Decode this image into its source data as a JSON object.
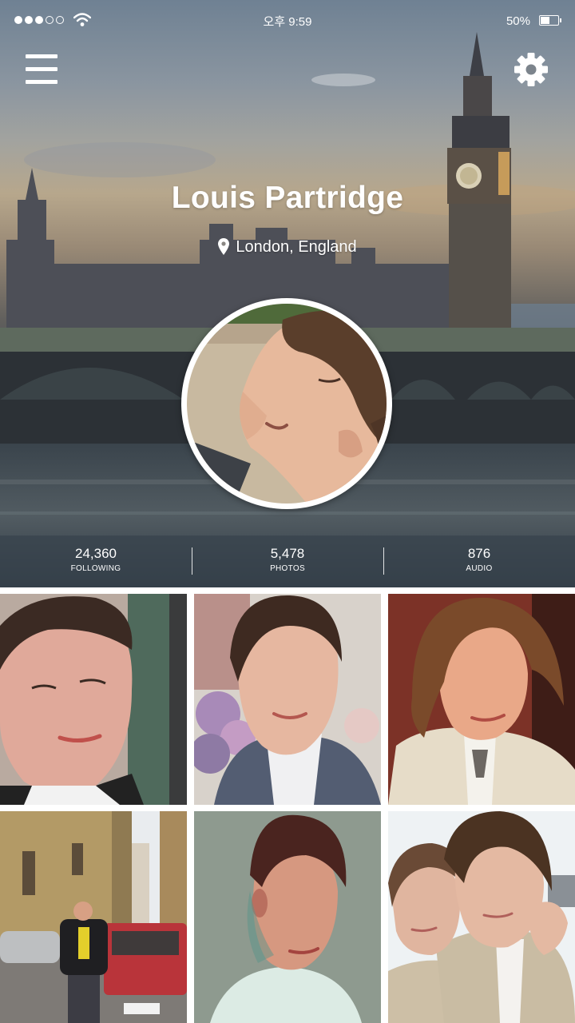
{
  "status_bar": {
    "signal": "●●●○○",
    "wifi_icon": "wifi-icon",
    "time": "오후 9:59",
    "battery_percent": "50%",
    "battery_level": 0.5
  },
  "nav": {
    "menu_icon": "hamburger-menu-icon",
    "settings_icon": "gear-icon"
  },
  "profile": {
    "name": "Louis Partridge",
    "location": "London, England",
    "location_icon": "map-pin-icon"
  },
  "stats": [
    {
      "value": "24,360",
      "label": "FOLLOWING"
    },
    {
      "value": "5,478",
      "label": "PHOTOS"
    },
    {
      "value": "876",
      "label": "AUDIO"
    }
  ],
  "colors": {
    "stats_bar": "#37424c",
    "text": "#ffffff",
    "sky_top": "#6f8193",
    "sky_sunset": "#b7a78c"
  }
}
